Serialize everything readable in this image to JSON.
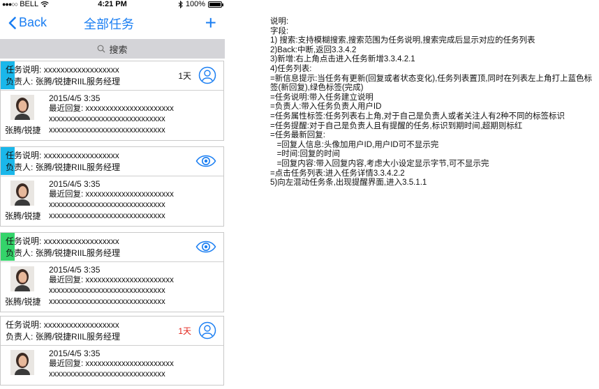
{
  "status_bar": {
    "carrier": "BELL",
    "time": "4:21 PM",
    "battery": "100%"
  },
  "nav": {
    "back_label": "Back",
    "title": "全部任务",
    "add_label": "+"
  },
  "search": {
    "label": "搜索"
  },
  "tasks": [
    {
      "desc_label": "任务说明:",
      "desc_value": "xxxxxxxxxxxxxxxxxx",
      "owner_label": "负责人:",
      "owner_value": "张腾/锐捷RIIL服务经理",
      "days": "1天",
      "tag_color": "#1ab7ea",
      "icon": "person-circle-icon",
      "reply_date": "2015/4/5 3:35",
      "reply_label": "最近回复:",
      "reply_line1": "xxxxxxxxxxxxxxxxxxxxxx",
      "reply_line2": "xxxxxxxxxxxxxxxxxxxxxxxxxxxxx",
      "reply_user": "张腾/锐捷",
      "reply_line3": "xxxxxxxxxxxxxxxxxxxxxxxxxxxxx"
    },
    {
      "desc_label": "任务说明:",
      "desc_value": "xxxxxxxxxxxxxxxxxx",
      "owner_label": "负责人:",
      "owner_value": "张腾/锐捷RIIL服务经理",
      "days": "",
      "tag_color": "#1ab7ea",
      "icon": "eye-icon",
      "reply_date": "2015/4/5 3:35",
      "reply_label": "最近回复:",
      "reply_line1": "xxxxxxxxxxxxxxxxxxxxxx",
      "reply_line2": "xxxxxxxxxxxxxxxxxxxxxxxxxxxxx",
      "reply_user": "张腾/锐捷",
      "reply_line3": "xxxxxxxxxxxxxxxxxxxxxxxxxxxxx"
    },
    {
      "desc_label": "任务说明:",
      "desc_value": "xxxxxxxxxxxxxxxxxx",
      "owner_label": "负责人:",
      "owner_value": "张腾/锐捷RIIL服务经理",
      "days": "",
      "tag_color": "#34d46a",
      "icon": "eye-icon",
      "reply_date": "2015/4/5 3:35",
      "reply_label": "最近回复:",
      "reply_line1": "xxxxxxxxxxxxxxxxxxxxxx",
      "reply_line2": "xxxxxxxxxxxxxxxxxxxxxxxxxxxxx",
      "reply_user": "张腾/锐捷",
      "reply_line3": "xxxxxxxxxxxxxxxxxxxxxxxxxxxxx"
    },
    {
      "desc_label": "任务说明:",
      "desc_value": "xxxxxxxxxxxxxxxxxx",
      "owner_label": "负责人:",
      "owner_value": "张腾/锐捷RIIL服务经理",
      "days": "1天",
      "days_color": "#e2231a",
      "tag_color": "",
      "icon": "person-circle-icon",
      "reply_date": "2015/4/5 3:35",
      "reply_label": "最近回复:",
      "reply_line1": "xxxxxxxxxxxxxxxxxxxxxx",
      "reply_line2": "xxxxxxxxxxxxxxxxxxxxxxxxxxxxx"
    }
  ],
  "notes": {
    "lines": [
      "说明:",
      "",
      "字段:",
      "1) 搜索:支持模糊搜索,搜索范围为任务说明,搜索完成后显示对应的任务列表",
      "2)Back:中断,返回3.3.4.2",
      "3)新增:右上角点击进入任务新增3.3.4.2.1",
      "4)任务列表:",
      "=新信息提示:当任务有更新(回复或者状态变化),任务列表置顶,同时在列表左上角打上蓝色标签(新回复),绿色标签(完成)",
      "=任务说明:带入任务建立说明",
      "=负责人:带入任务负责人用户ID",
      "=任务属性标签:任务列表右上角,对于自己是负责人或者关注人有2种不同的标签标识",
      "=任务提醒:对于自己是负责人且有提醒的任务,标识到期时间,超期则标红",
      "=任务最新回复:",
      "   =回复人信息:头像加用户ID,用户ID可不显示完",
      "   =时间:回复的时间",
      "   =回复内容:带入回复内容,考虑大小设定显示字节,可不显示完",
      "=点击任务列表:进入任务详情3.3.4.2.2",
      "5)向左混动任务条,出现提醒界面,进入3.5.1.1"
    ]
  }
}
